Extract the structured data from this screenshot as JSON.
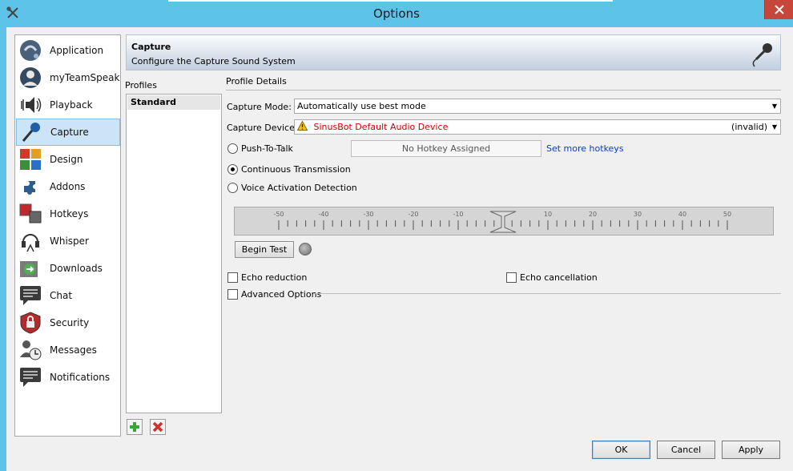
{
  "window": {
    "title": "Options"
  },
  "sidebar": {
    "items": [
      {
        "label": "Application",
        "icon": "application-icon"
      },
      {
        "label": "myTeamSpeak",
        "icon": "user-icon"
      },
      {
        "label": "Playback",
        "icon": "speaker-icon"
      },
      {
        "label": "Capture",
        "icon": "microphone-icon",
        "selected": true
      },
      {
        "label": "Design",
        "icon": "design-icon"
      },
      {
        "label": "Addons",
        "icon": "puzzle-icon"
      },
      {
        "label": "Hotkeys",
        "icon": "keyboard-icon"
      },
      {
        "label": "Whisper",
        "icon": "headset-icon"
      },
      {
        "label": "Downloads",
        "icon": "downloads-icon"
      },
      {
        "label": "Chat",
        "icon": "chat-icon"
      },
      {
        "label": "Security",
        "icon": "lock-icon"
      },
      {
        "label": "Messages",
        "icon": "messages-icon"
      },
      {
        "label": "Notifications",
        "icon": "notifications-icon"
      }
    ]
  },
  "header": {
    "title": "Capture",
    "subtitle": "Configure the Capture Sound System"
  },
  "profiles": {
    "label": "Profiles",
    "items": [
      "Standard"
    ]
  },
  "details": {
    "label": "Profile Details",
    "capture_mode": {
      "label": "Capture Mode:",
      "value": "Automatically use best mode"
    },
    "capture_device": {
      "label": "Capture Device:",
      "value": "SinusBot Default Audio Device",
      "status": "(invalid)"
    },
    "push_to_talk": {
      "label": "Push-To-Talk",
      "checked": false
    },
    "hotkey_placeholder": "No Hotkey Assigned",
    "set_hotkeys_link": "Set more hotkeys",
    "continuous": {
      "label": "Continuous Transmission",
      "checked": true
    },
    "vad": {
      "label": "Voice Activation Detection",
      "checked": false
    },
    "meter": {
      "ticks": [
        "-50",
        "-40",
        "-30",
        "-20",
        "-10",
        "0",
        "10",
        "20",
        "30",
        "40",
        "50"
      ]
    },
    "begin_test": "Begin Test",
    "echo_reduction": {
      "label": "Echo reduction",
      "checked": false
    },
    "echo_cancellation": {
      "label": "Echo cancellation",
      "checked": false
    },
    "advanced": {
      "label": "Advanced Options",
      "checked": false
    }
  },
  "buttons": {
    "ok": "OK",
    "cancel": "Cancel",
    "apply": "Apply"
  },
  "colors": {
    "titlebar": "#5ec3e9",
    "close": "#c7463a",
    "warning_text": "#cc0000",
    "link": "#0a3ec2",
    "selection": "#cce4f7"
  }
}
